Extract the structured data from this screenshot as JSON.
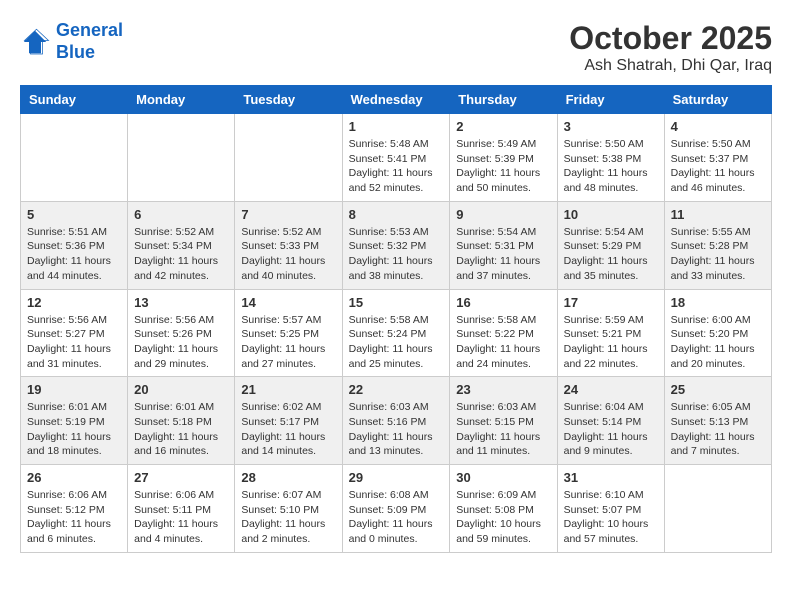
{
  "header": {
    "logo_line1": "General",
    "logo_line2": "Blue",
    "month": "October 2025",
    "location": "Ash Shatrah, Dhi Qar, Iraq"
  },
  "days_of_week": [
    "Sunday",
    "Monday",
    "Tuesday",
    "Wednesday",
    "Thursday",
    "Friday",
    "Saturday"
  ],
  "weeks": [
    [
      {
        "day": "",
        "info": ""
      },
      {
        "day": "",
        "info": ""
      },
      {
        "day": "",
        "info": ""
      },
      {
        "day": "1",
        "info": "Sunrise: 5:48 AM\nSunset: 5:41 PM\nDaylight: 11 hours\nand 52 minutes."
      },
      {
        "day": "2",
        "info": "Sunrise: 5:49 AM\nSunset: 5:39 PM\nDaylight: 11 hours\nand 50 minutes."
      },
      {
        "day": "3",
        "info": "Sunrise: 5:50 AM\nSunset: 5:38 PM\nDaylight: 11 hours\nand 48 minutes."
      },
      {
        "day": "4",
        "info": "Sunrise: 5:50 AM\nSunset: 5:37 PM\nDaylight: 11 hours\nand 46 minutes."
      }
    ],
    [
      {
        "day": "5",
        "info": "Sunrise: 5:51 AM\nSunset: 5:36 PM\nDaylight: 11 hours\nand 44 minutes."
      },
      {
        "day": "6",
        "info": "Sunrise: 5:52 AM\nSunset: 5:34 PM\nDaylight: 11 hours\nand 42 minutes."
      },
      {
        "day": "7",
        "info": "Sunrise: 5:52 AM\nSunset: 5:33 PM\nDaylight: 11 hours\nand 40 minutes."
      },
      {
        "day": "8",
        "info": "Sunrise: 5:53 AM\nSunset: 5:32 PM\nDaylight: 11 hours\nand 38 minutes."
      },
      {
        "day": "9",
        "info": "Sunrise: 5:54 AM\nSunset: 5:31 PM\nDaylight: 11 hours\nand 37 minutes."
      },
      {
        "day": "10",
        "info": "Sunrise: 5:54 AM\nSunset: 5:29 PM\nDaylight: 11 hours\nand 35 minutes."
      },
      {
        "day": "11",
        "info": "Sunrise: 5:55 AM\nSunset: 5:28 PM\nDaylight: 11 hours\nand 33 minutes."
      }
    ],
    [
      {
        "day": "12",
        "info": "Sunrise: 5:56 AM\nSunset: 5:27 PM\nDaylight: 11 hours\nand 31 minutes."
      },
      {
        "day": "13",
        "info": "Sunrise: 5:56 AM\nSunset: 5:26 PM\nDaylight: 11 hours\nand 29 minutes."
      },
      {
        "day": "14",
        "info": "Sunrise: 5:57 AM\nSunset: 5:25 PM\nDaylight: 11 hours\nand 27 minutes."
      },
      {
        "day": "15",
        "info": "Sunrise: 5:58 AM\nSunset: 5:24 PM\nDaylight: 11 hours\nand 25 minutes."
      },
      {
        "day": "16",
        "info": "Sunrise: 5:58 AM\nSunset: 5:22 PM\nDaylight: 11 hours\nand 24 minutes."
      },
      {
        "day": "17",
        "info": "Sunrise: 5:59 AM\nSunset: 5:21 PM\nDaylight: 11 hours\nand 22 minutes."
      },
      {
        "day": "18",
        "info": "Sunrise: 6:00 AM\nSunset: 5:20 PM\nDaylight: 11 hours\nand 20 minutes."
      }
    ],
    [
      {
        "day": "19",
        "info": "Sunrise: 6:01 AM\nSunset: 5:19 PM\nDaylight: 11 hours\nand 18 minutes."
      },
      {
        "day": "20",
        "info": "Sunrise: 6:01 AM\nSunset: 5:18 PM\nDaylight: 11 hours\nand 16 minutes."
      },
      {
        "day": "21",
        "info": "Sunrise: 6:02 AM\nSunset: 5:17 PM\nDaylight: 11 hours\nand 14 minutes."
      },
      {
        "day": "22",
        "info": "Sunrise: 6:03 AM\nSunset: 5:16 PM\nDaylight: 11 hours\nand 13 minutes."
      },
      {
        "day": "23",
        "info": "Sunrise: 6:03 AM\nSunset: 5:15 PM\nDaylight: 11 hours\nand 11 minutes."
      },
      {
        "day": "24",
        "info": "Sunrise: 6:04 AM\nSunset: 5:14 PM\nDaylight: 11 hours\nand 9 minutes."
      },
      {
        "day": "25",
        "info": "Sunrise: 6:05 AM\nSunset: 5:13 PM\nDaylight: 11 hours\nand 7 minutes."
      }
    ],
    [
      {
        "day": "26",
        "info": "Sunrise: 6:06 AM\nSunset: 5:12 PM\nDaylight: 11 hours\nand 6 minutes."
      },
      {
        "day": "27",
        "info": "Sunrise: 6:06 AM\nSunset: 5:11 PM\nDaylight: 11 hours\nand 4 minutes."
      },
      {
        "day": "28",
        "info": "Sunrise: 6:07 AM\nSunset: 5:10 PM\nDaylight: 11 hours\nand 2 minutes."
      },
      {
        "day": "29",
        "info": "Sunrise: 6:08 AM\nSunset: 5:09 PM\nDaylight: 11 hours\nand 0 minutes."
      },
      {
        "day": "30",
        "info": "Sunrise: 6:09 AM\nSunset: 5:08 PM\nDaylight: 10 hours\nand 59 minutes."
      },
      {
        "day": "31",
        "info": "Sunrise: 6:10 AM\nSunset: 5:07 PM\nDaylight: 10 hours\nand 57 minutes."
      },
      {
        "day": "",
        "info": ""
      }
    ]
  ]
}
